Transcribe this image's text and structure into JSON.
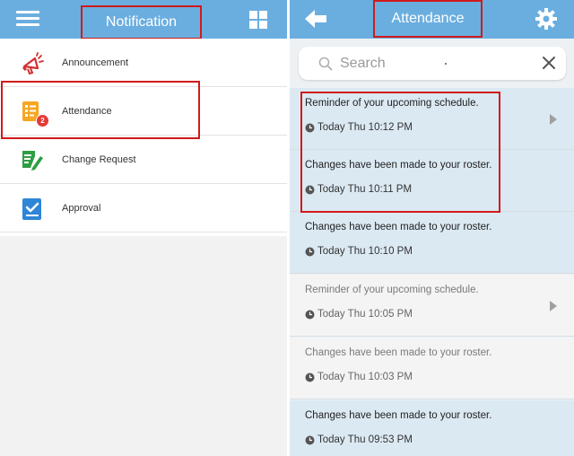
{
  "left": {
    "title": "Notification",
    "menu": [
      {
        "label": "Announcement",
        "icon": "megaphone-icon"
      },
      {
        "label": "Attendance",
        "icon": "checklist-icon",
        "badge": "2"
      },
      {
        "label": "Change Request",
        "icon": "edit-document-icon"
      },
      {
        "label": "Approval",
        "icon": "check-clipboard-icon"
      }
    ]
  },
  "right": {
    "title": "Attendance",
    "search": {
      "placeholder": "Search",
      "value": ""
    },
    "notifications": [
      {
        "message": "Reminder of your upcoming schedule.",
        "time": "Today Thu 10:12 PM",
        "read": false,
        "has_arrow": true
      },
      {
        "message": "Changes have been made to your roster.",
        "time": "Today Thu 10:11 PM",
        "read": false,
        "has_arrow": false
      },
      {
        "message": "Changes have been made to your roster.",
        "time": "Today Thu 10:10 PM",
        "read": false,
        "has_arrow": false
      },
      {
        "message": "Reminder of your upcoming schedule.",
        "time": "Today Thu 10:05 PM",
        "read": true,
        "has_arrow": true
      },
      {
        "message": "Changes have been made to your roster.",
        "time": "Today Thu 10:03 PM",
        "read": true,
        "has_arrow": false
      },
      {
        "message": "Changes have been made to your roster.",
        "time": "Today Thu 09:53 PM",
        "read": false,
        "has_arrow": false
      }
    ]
  },
  "colors": {
    "header": "#6aaee0",
    "highlight": "#d11a1a",
    "unread": "#dbe9f3",
    "badge": "#e53935"
  }
}
